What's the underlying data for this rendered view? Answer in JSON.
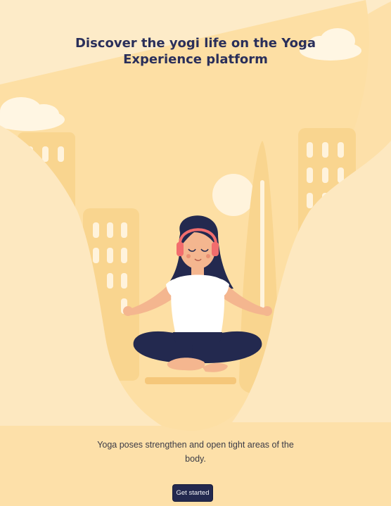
{
  "heading": "Discover the yogi life on the Yoga Experience platform",
  "description": "Yoga poses strengthen and open tight areas of the body.",
  "cta_label": "Get started",
  "colors": {
    "background": "#fdebc8",
    "building": "#f9d58f",
    "heading": "#2a2f5a",
    "button": "#23294f",
    "headphones": "#f26d6d"
  }
}
